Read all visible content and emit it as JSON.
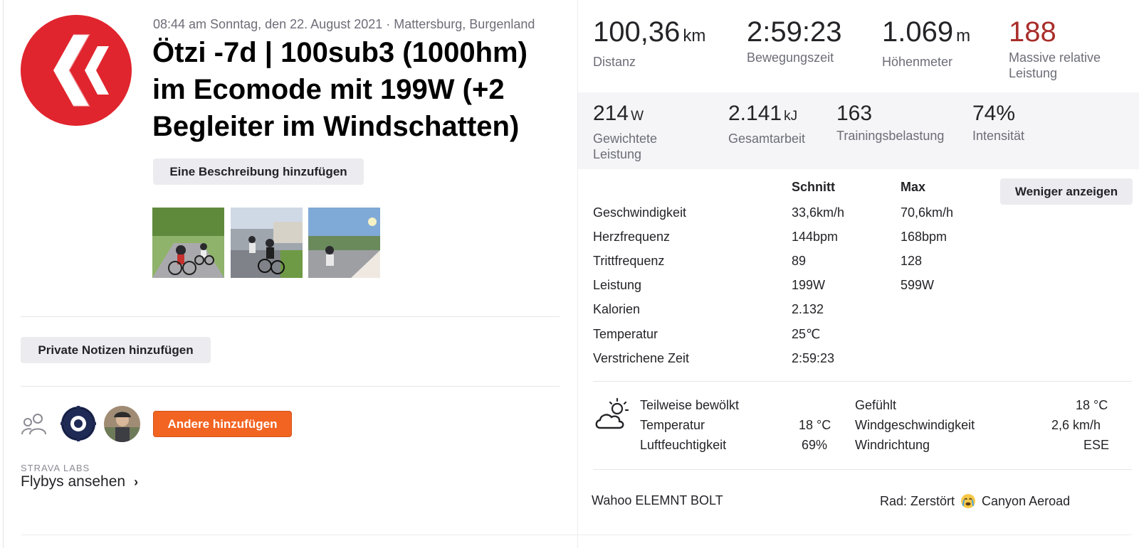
{
  "activity": {
    "meta": "08:44 am Sonntag, den 22. August 2021 · Mattersburg, Burgenland",
    "title": "Ötzi -7d | 100sub3 (1000hm) im Ecomode mit 199W (+2 Begleiter im Windschatten)",
    "add_description_label": "Eine Beschreibung hinzufügen",
    "private_notes_label": "Private Notizen hinzufügen",
    "add_others_label": "Andere hinzufügen",
    "labs_tag": "STRAVA LABS",
    "flybys_label": "Flybys ansehen",
    "flybys_chevron": "›"
  },
  "colors": {
    "brand_red": "#e0252e",
    "relative_effort_red": "#a92e2a",
    "add_button_orange": "#f26422"
  },
  "icons": {
    "logo": "chevron-logo-icon",
    "group": "group-icon",
    "gear_avatar": "gear-icon",
    "weather": "partly-cloudy-icon",
    "emoji": "crying-face-icon"
  },
  "primary_stats": [
    {
      "value": "100,36",
      "unit": "km",
      "label": "Distanz"
    },
    {
      "value": "2:59:23",
      "unit": "",
      "label": "Bewegungszeit"
    },
    {
      "value": "1.069",
      "unit": "m",
      "label": "Höhenmeter"
    },
    {
      "value": "188",
      "unit": "",
      "label": "Massive relative Leistung"
    }
  ],
  "secondary_stats": [
    {
      "value": "214",
      "unit": "W",
      "label": "Gewichtete Leistung"
    },
    {
      "value": "2.141",
      "unit": "kJ",
      "label": "Gesamtarbeit"
    },
    {
      "value": "163",
      "unit": "",
      "label": "Trainingsbelastung"
    },
    {
      "value": "74%",
      "unit": "",
      "label": "Intensität"
    }
  ],
  "table": {
    "header_avg": "Schnitt",
    "header_max": "Max",
    "show_less_label": "Weniger anzeigen",
    "rows": [
      {
        "label": "Geschwindigkeit",
        "avg": "33,6km/h",
        "max": "70,6km/h"
      },
      {
        "label": "Herzfrequenz",
        "avg": "144bpm",
        "max": "168bpm"
      },
      {
        "label": "Trittfrequenz",
        "avg": "89",
        "max": "128"
      },
      {
        "label": "Leistung",
        "avg": "199W",
        "max": "599W"
      },
      {
        "label": "Kalorien",
        "avg": "2.132",
        "max": ""
      },
      {
        "label": "Temperatur",
        "avg": "25℃",
        "max": ""
      },
      {
        "label": "Verstrichene Zeit",
        "avg": "2:59:23",
        "max": ""
      }
    ]
  },
  "weather": {
    "condition": "Teilweise bewölkt",
    "temp_label": "Temperatur",
    "temp_value": "18 °C",
    "humidity_label": "Luftfeuchtigkeit",
    "humidity_value": "69%",
    "feels_label": "Gefühlt",
    "feels_value": "18 °C",
    "wind_speed_label": "Windgeschwindigkeit",
    "wind_speed_value": "2,6 km/h",
    "wind_dir_label": "Windrichtung",
    "wind_dir_value": "ESE"
  },
  "equipment": {
    "device": "Wahoo ELEMNT BOLT",
    "bike_prefix": "Rad: Zerstört",
    "bike_name": "Canyon Aeroad"
  }
}
